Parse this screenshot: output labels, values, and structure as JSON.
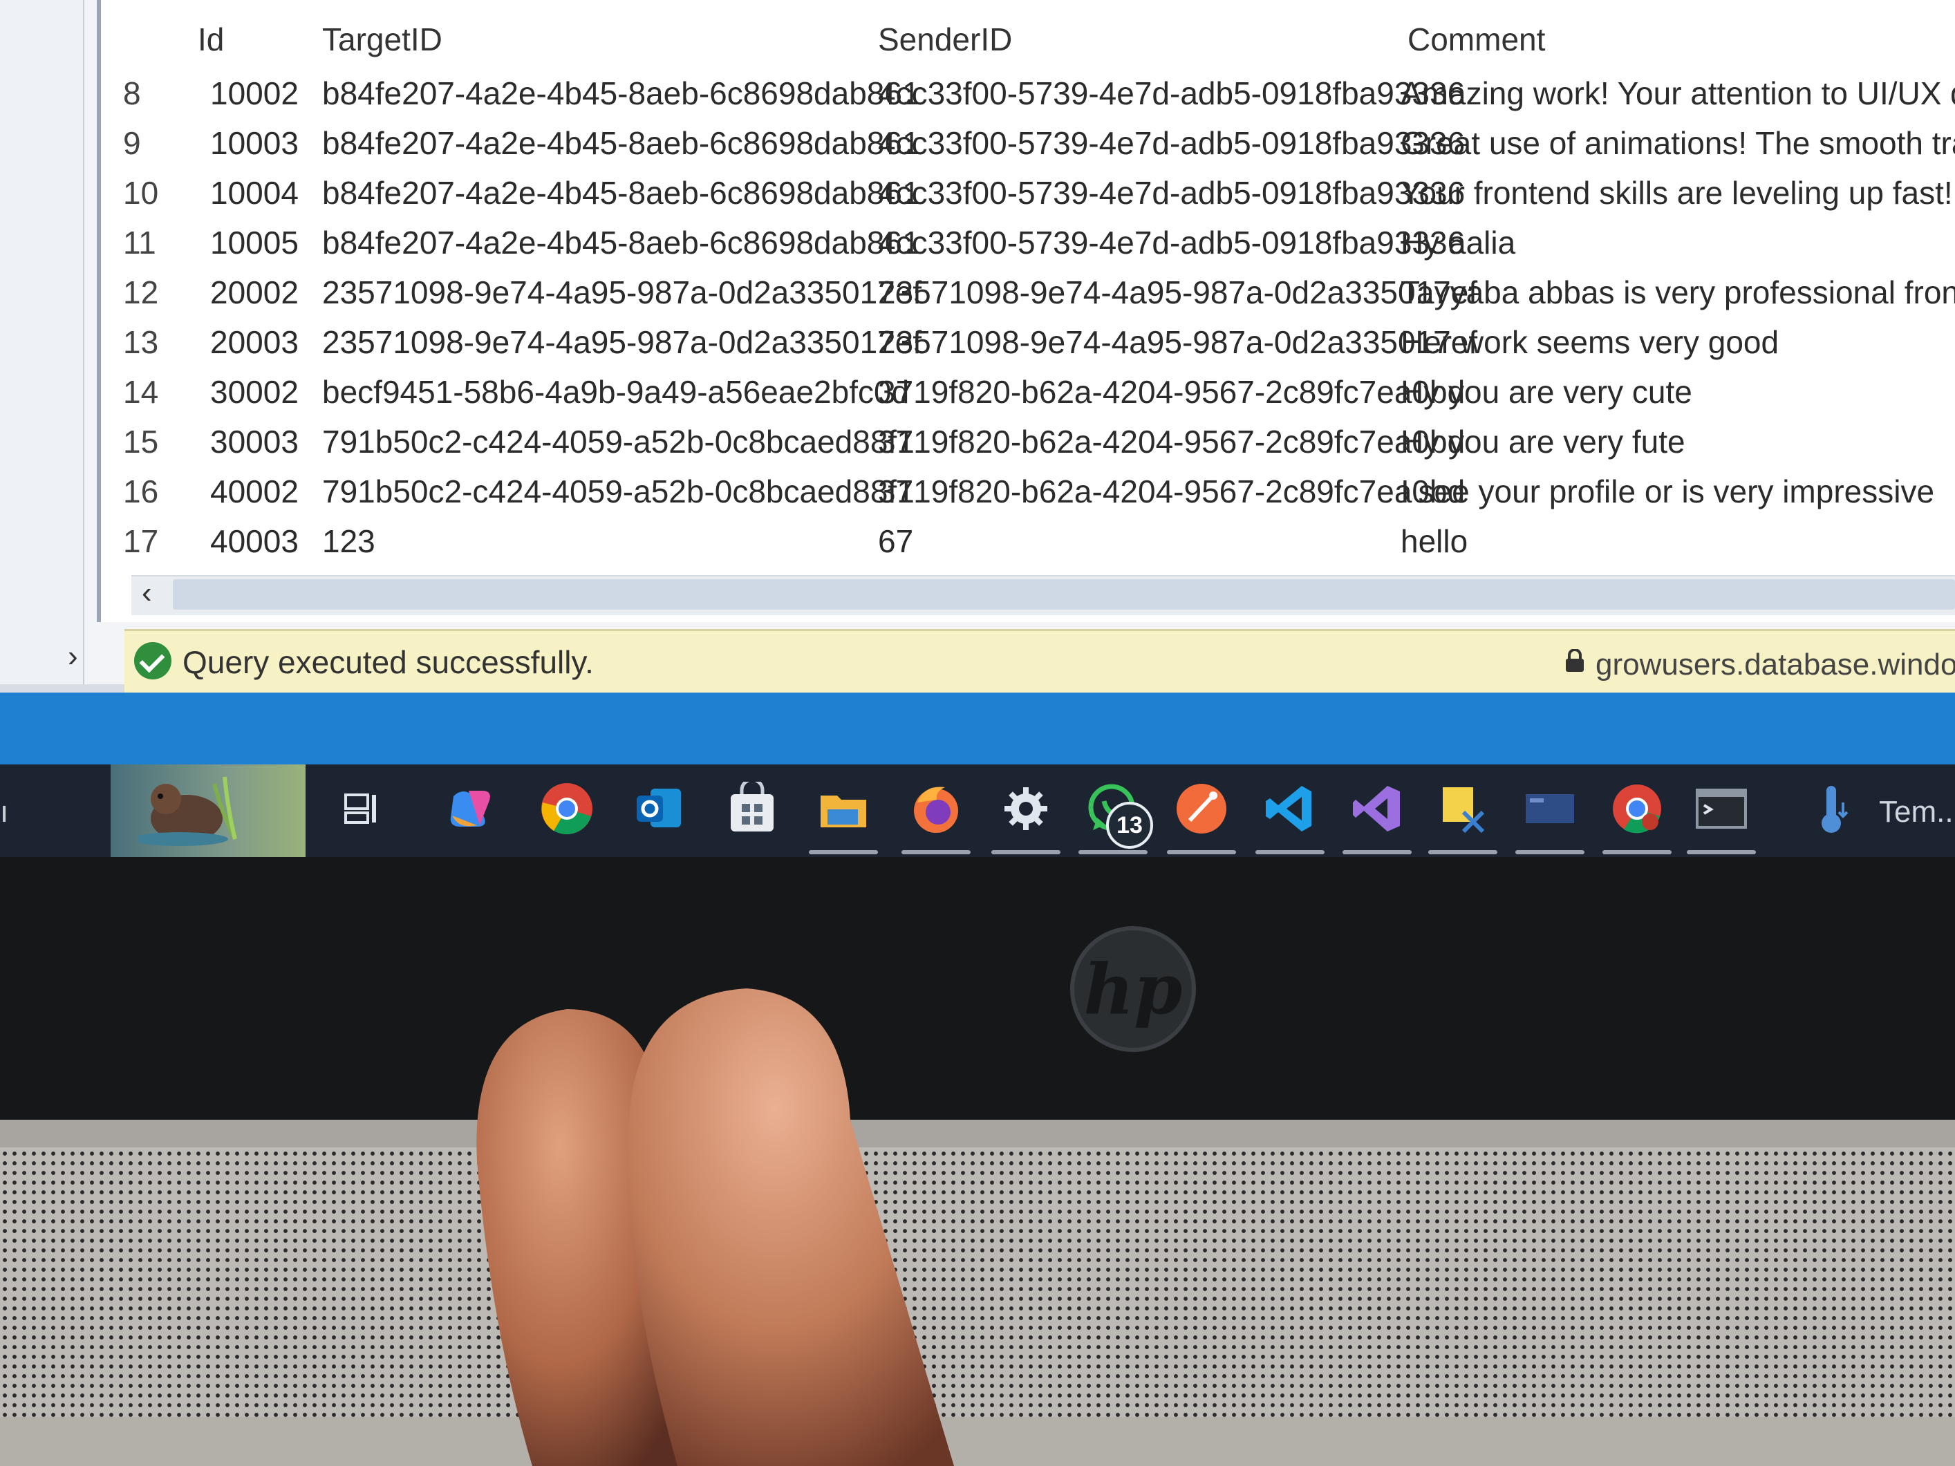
{
  "results_grid": {
    "columns": {
      "id": "Id",
      "target_id": "TargetID",
      "sender_id": "SenderID",
      "comment": "Comment"
    },
    "rows": [
      {
        "row_number": "8",
        "id": "10002",
        "target_id": "b84fe207-4a2e-4b45-8aeb-6c8698dab861",
        "sender_id": "4cc33f00-5739-4e7d-adb5-0918fba93336",
        "comment": "Amazing work! Your attention to UI/UX details is"
      },
      {
        "row_number": "9",
        "id": "10003",
        "target_id": "b84fe207-4a2e-4b45-8aeb-6c8698dab861",
        "sender_id": "4cc33f00-5739-4e7d-adb5-0918fba93336",
        "comment": "Great use of animations! The smooth transitions m"
      },
      {
        "row_number": "10",
        "id": "10004",
        "target_id": "b84fe207-4a2e-4b45-8aeb-6c8698dab861",
        "sender_id": "4cc33f00-5739-4e7d-adb5-0918fba93336",
        "comment": "Your frontend skills are leveling up fast! Can't wai"
      },
      {
        "row_number": "11",
        "id": "10005",
        "target_id": "b84fe207-4a2e-4b45-8aeb-6c8698dab861",
        "sender_id": "4cc33f00-5739-4e7d-adb5-0918fba93336",
        "comment": "Hy aalia"
      },
      {
        "row_number": "12",
        "id": "20002",
        "target_id": "23571098-9e74-4a95-987a-0d2a335017ef",
        "sender_id": "23571098-9e74-4a95-987a-0d2a335017ef",
        "comment": "Tayyaba abbas is very professional frontend deve"
      },
      {
        "row_number": "13",
        "id": "20003",
        "target_id": "23571098-9e74-4a95-987a-0d2a335017ef",
        "sender_id": "23571098-9e74-4a95-987a-0d2a335017ef",
        "comment": "Her work seems very good"
      },
      {
        "row_number": "14",
        "id": "30002",
        "target_id": "becf9451-58b6-4a9b-9a49-a56eae2bfc0d",
        "sender_id": "3719f820-b62a-4204-9567-2c89fc7ea0bd",
        "comment": "Hy you are very cute"
      },
      {
        "row_number": "15",
        "id": "30003",
        "target_id": "791b50c2-c424-4059-a52b-0c8bcaed88f1",
        "sender_id": "3719f820-b62a-4204-9567-2c89fc7ea0bd",
        "comment": "Hy you are very fute"
      },
      {
        "row_number": "16",
        "id": "40002",
        "target_id": "791b50c2-c424-4059-a52b-0c8bcaed88f1",
        "sender_id": "3719f820-b62a-4204-9567-2c89fc7ea0bd",
        "comment": "I see your profile or is very impressive"
      },
      {
        "row_number": "17",
        "id": "40003",
        "target_id": "123",
        "sender_id": "67",
        "comment": "hello"
      }
    ]
  },
  "status_bar": {
    "message": "Query executed successfully.",
    "server": "growusers.database.windows."
  },
  "taskbar": {
    "icons": [
      "widgets-icon",
      "task-view-icon",
      "copilot-icon",
      "chrome-icon",
      "outlook-icon",
      "store-icon",
      "file-explorer-icon",
      "firefox-icon",
      "settings-icon",
      "whatsapp-icon",
      "postman-icon",
      "vscode-icon",
      "visual-studio-icon",
      "sticky-notes-icon",
      "remote-desktop-icon",
      "chrome-app-icon",
      "terminal-icon",
      "thermometer-icon"
    ],
    "whatsapp_badge": "13",
    "temperature_label": "Tem..."
  },
  "hardware": {
    "logo_text": "hp"
  },
  "colors": {
    "status_bar_bg": "#f6f2c5",
    "success_green": "#2f8f3c",
    "taskbar_bg": "#1b2430",
    "accent_blue": "#1f7fd0"
  }
}
